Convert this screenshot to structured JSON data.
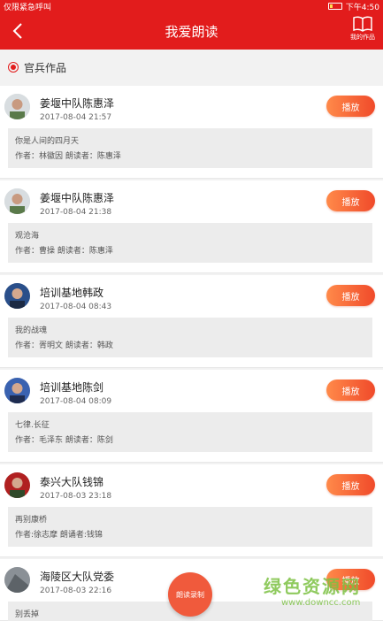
{
  "status_bar": {
    "carrier": "仅限紧急呼叫",
    "time": "下午4:50"
  },
  "header": {
    "title": "我爱朗读",
    "my_works_label": "我的作品"
  },
  "section": {
    "title": "官兵作品"
  },
  "cards": [
    {
      "name": "姜堰中队陈惠泽",
      "time": "2017-08-04 21:57",
      "play_label": "播放",
      "poem": "你是人间的四月天",
      "meta": "作者：林徽因   朗读者：陈惠泽"
    },
    {
      "name": "姜堰中队陈惠泽",
      "time": "2017-08-04 21:38",
      "play_label": "播放",
      "poem": "观沧海",
      "meta": "作者：曹操   朗读者：陈惠泽"
    },
    {
      "name": "培训基地韩政",
      "time": "2017-08-04 08:43",
      "play_label": "播放",
      "poem": "我的战魂",
      "meta": "作者：胥明文   朗读者：韩政"
    },
    {
      "name": "培训基地陈剑",
      "time": "2017-08-04 08:09",
      "play_label": "播放",
      "poem": "七律.长征",
      "meta": "作者：毛泽东   朗读者：陈剑"
    },
    {
      "name": "泰兴大队钱锦",
      "time": "2017-08-03 23:18",
      "play_label": "播放",
      "poem": "再别康桥",
      "meta": "作者:徐志摩  朗诵者:钱锦"
    },
    {
      "name": "海陵区大队党委",
      "time": "2017-08-03 22:16",
      "play_label": "播放",
      "poem": "别丢掉",
      "meta": ""
    }
  ],
  "record_button": {
    "label": "朗读录制"
  },
  "watermark": {
    "brand": "绿色资源网",
    "url": "www.downcc.com"
  },
  "colors": {
    "primary": "#e21c1c",
    "play_button": "#f04a2a",
    "watermark": "#7cc143"
  }
}
